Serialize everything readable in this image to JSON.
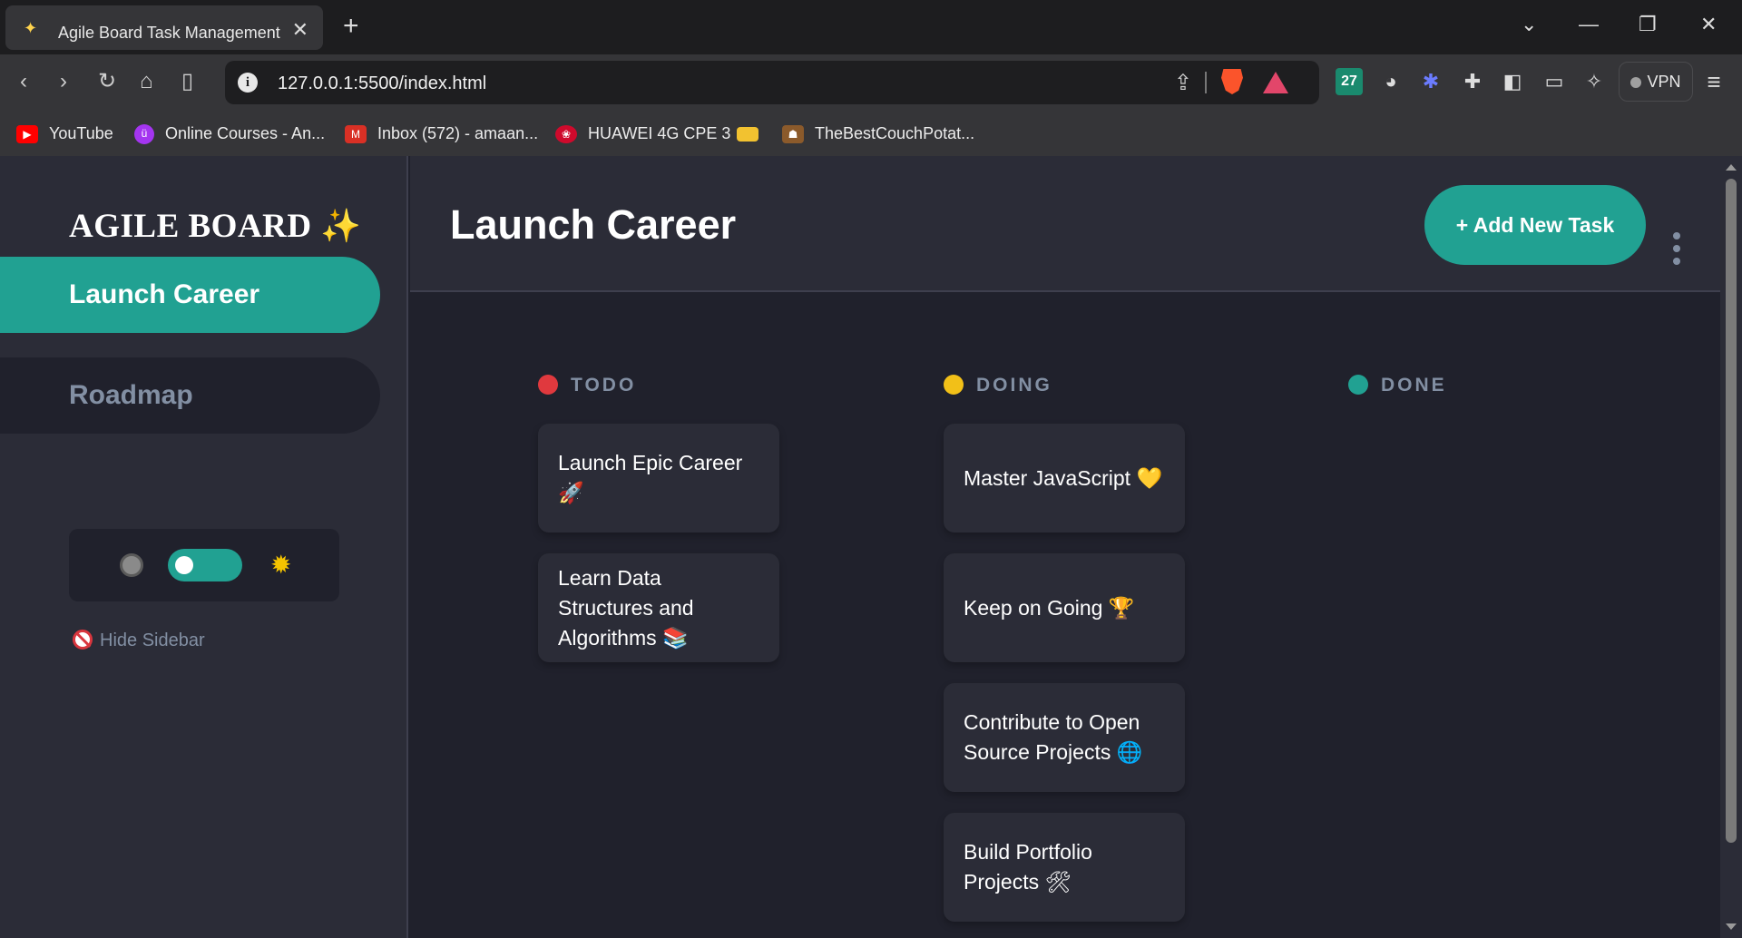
{
  "browser": {
    "tab_title": "Agile Board Task Management",
    "tab_icon": "sparkles-icon",
    "url": "127.0.0.1:5500/index.html",
    "vpn_label": "VPN",
    "ext_badge": "27"
  },
  "bookmarks": [
    {
      "label": "YouTube",
      "icon": "youtube-icon",
      "color": "#ff0000"
    },
    {
      "label": "Online Courses - An...",
      "icon": "udemy-icon",
      "color": "#a435f0"
    },
    {
      "label": "Inbox (572) - amaan...",
      "icon": "gmail-icon",
      "color": "#d93025"
    },
    {
      "label": "HUAWEI 4G CPE 3",
      "icon": "huawei-icon",
      "color": "#cf0a2c"
    },
    {
      "label": "",
      "icon": "folder-icon",
      "color": "#f2c230"
    },
    {
      "label": "TheBestCouchPotat...",
      "icon": "site-icon",
      "color": "#8b5a2b"
    }
  ],
  "sidebar": {
    "logo": "AGILE BOARD",
    "logo_emoji": "✨",
    "boards": [
      "Launch Career",
      "Roadmap"
    ],
    "hide_label": "Hide Sidebar"
  },
  "header": {
    "title": "Launch Career",
    "add_button": "+ Add New Task"
  },
  "columns": [
    {
      "name": "TODO",
      "color": "#e0393e",
      "tasks": [
        "Launch Epic Career 🚀",
        "Learn Data Structures and Algorithms 📚"
      ]
    },
    {
      "name": "DOING",
      "color": "#f2c018",
      "tasks": [
        "Master JavaScript 💛",
        "Keep on Going 🏆",
        "Contribute to Open Source Projects 🌐",
        "Build Portfolio Projects 🛠"
      ]
    },
    {
      "name": "DONE",
      "color": "#21a192",
      "tasks": []
    }
  ]
}
